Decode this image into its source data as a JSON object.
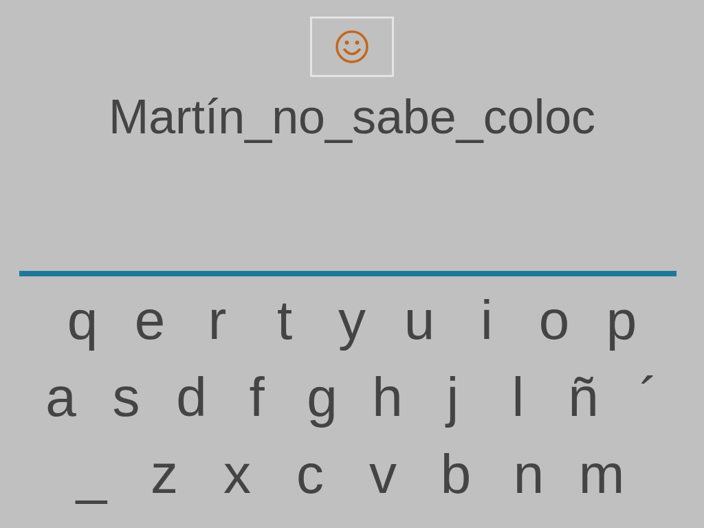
{
  "prompt": "Martín_no_sabe_coloc",
  "keyboard": {
    "rows": [
      [
        "q",
        "e",
        "r",
        "t",
        "y",
        "u",
        "i",
        "o",
        "p"
      ],
      [
        "a",
        "s",
        "d",
        "f",
        "g",
        "h",
        "j",
        "l",
        "ñ",
        "´"
      ],
      [
        "_",
        "z",
        "x",
        "c",
        "v",
        "b",
        "n",
        "m"
      ]
    ]
  }
}
